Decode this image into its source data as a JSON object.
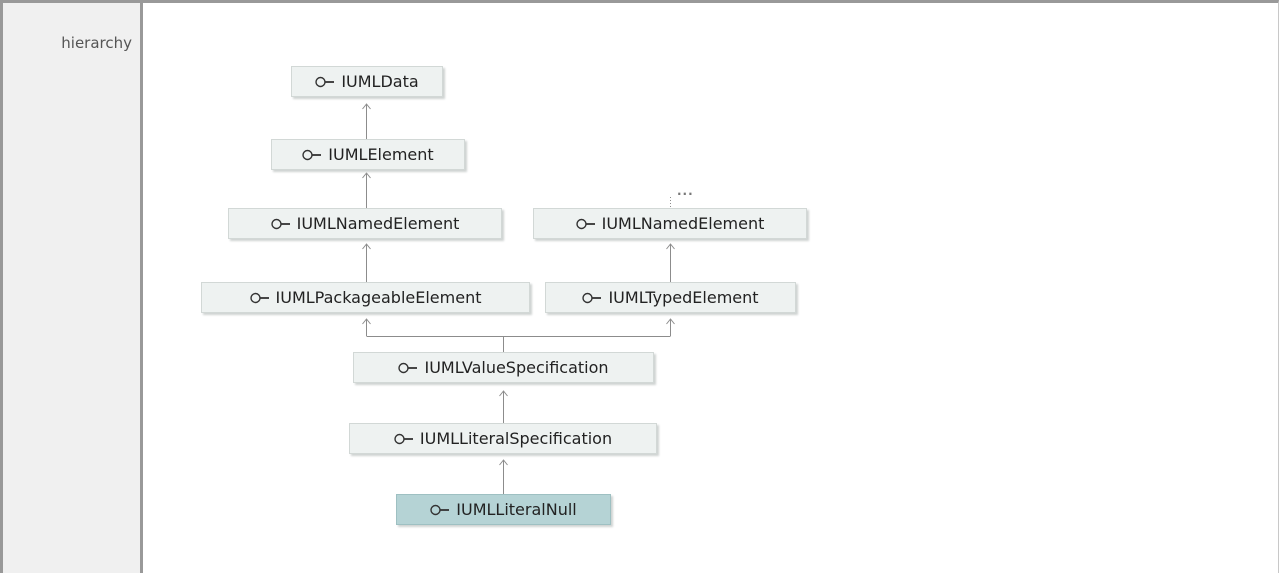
{
  "section_label": "hierarchy",
  "overflow_marker": "...",
  "nodes": {
    "uml_data": {
      "label": "IUMLData",
      "icon": "interface-icon"
    },
    "uml_element": {
      "label": "IUMLElement",
      "icon": "interface-icon"
    },
    "uml_named_element_left": {
      "label": "IUMLNamedElement",
      "icon": "interface-icon"
    },
    "uml_named_element_right": {
      "label": "IUMLNamedElement",
      "icon": "interface-icon"
    },
    "uml_packageable_element": {
      "label": "IUMLPackageableElement",
      "icon": "interface-icon"
    },
    "uml_typed_element": {
      "label": "IUMLTypedElement",
      "icon": "interface-icon"
    },
    "uml_value_specification": {
      "label": "IUMLValueSpecification",
      "icon": "interface-icon"
    },
    "uml_literal_specification": {
      "label": "IUMLLiteralSpecification",
      "icon": "interface-icon"
    },
    "uml_literal_null": {
      "label": "IUMLLiteralNull",
      "icon": "interface-icon",
      "current": true
    }
  },
  "colors": {
    "node_fill": "#eef2f1",
    "current_node_fill": "#b5d3d5",
    "edge": "#8c8c8c",
    "frame": "#999999"
  }
}
